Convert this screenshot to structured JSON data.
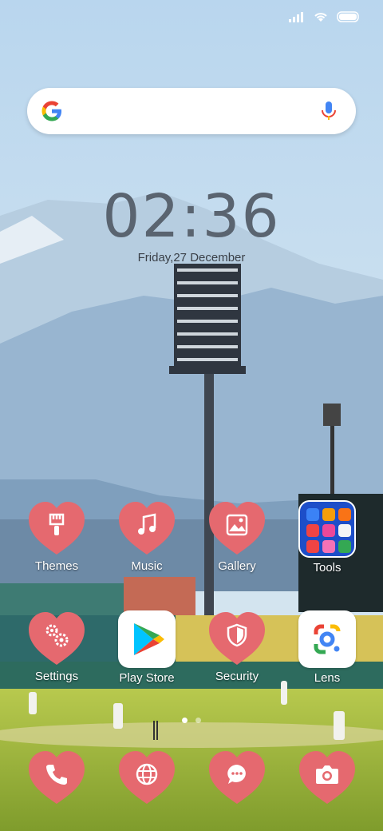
{
  "status": {
    "icons": [
      "signal-icon",
      "wifi-icon",
      "battery-icon"
    ]
  },
  "search": {
    "logo": "google-logo",
    "mic": "microphone-icon"
  },
  "clock": {
    "time": "02:36",
    "date": "Friday,27 December"
  },
  "apps_row1": [
    {
      "label": "Themes",
      "icon": "brush-icon"
    },
    {
      "label": "Music",
      "icon": "music-note-icon"
    },
    {
      "label": "Gallery",
      "icon": "image-icon"
    },
    {
      "label": "Tools",
      "icon": "folder-icon"
    }
  ],
  "apps_row2": [
    {
      "label": "Settings",
      "icon": "gear-icon"
    },
    {
      "label": "Play Store",
      "icon": "play-store-icon"
    },
    {
      "label": "Security",
      "icon": "shield-icon"
    },
    {
      "label": "Lens",
      "icon": "lens-icon"
    }
  ],
  "dock": [
    {
      "icon": "phone-icon"
    },
    {
      "icon": "globe-icon"
    },
    {
      "icon": "message-icon"
    },
    {
      "icon": "camera-icon"
    }
  ],
  "pages": {
    "count": 2,
    "active": 0
  },
  "colors": {
    "heart": "#e5696f",
    "folder": "#1d4ec8"
  }
}
